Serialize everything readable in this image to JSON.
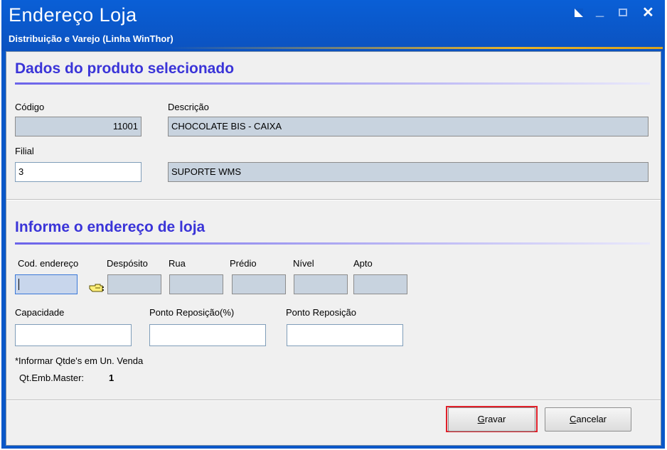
{
  "window": {
    "title": "Endereço Loja",
    "subtitle": "Distribuição e Varejo (Linha WinThor)"
  },
  "section_produto": {
    "title": "Dados do produto selecionado",
    "codigo_label": "Código",
    "codigo_value": "11001",
    "descricao_label": "Descrição",
    "descricao_value": "CHOCOLATE BIS  - CAIXA",
    "filial_label": "Filial",
    "filial_value": "3",
    "filial_nome_value": "SUPORTE WMS"
  },
  "section_endereco": {
    "title": "Informe o endereço de loja",
    "cod_endereco_label": "Cod. endereço",
    "deposito_label": "Despósito",
    "rua_label": "Rua",
    "predio_label": "Prédio",
    "nivel_label": "Nível",
    "apto_label": "Apto",
    "capacidade_label": "Capacidade",
    "ponto_rep_pct_label": "Ponto Reposição(%)",
    "ponto_rep_label": "Ponto Reposição",
    "note": "*Informar Qtde's em Un. Venda",
    "qt_emb_master_label": "Qt.Emb.Master:",
    "qt_emb_master_value": "1"
  },
  "buttons": {
    "gravar_first": "G",
    "gravar_rest": "ravar",
    "cancelar_first": "C",
    "cancelar_rest": "ancelar"
  },
  "colors": {
    "titlebar": "#0a57c8",
    "section_title": "#3a34d8",
    "readonly_field": "#c8d3df",
    "highlight_frame": "#e0202a"
  },
  "icons": [
    "restore-icon",
    "minimize-icon",
    "maximize-icon",
    "close-icon",
    "pointing-hand-icon"
  ]
}
